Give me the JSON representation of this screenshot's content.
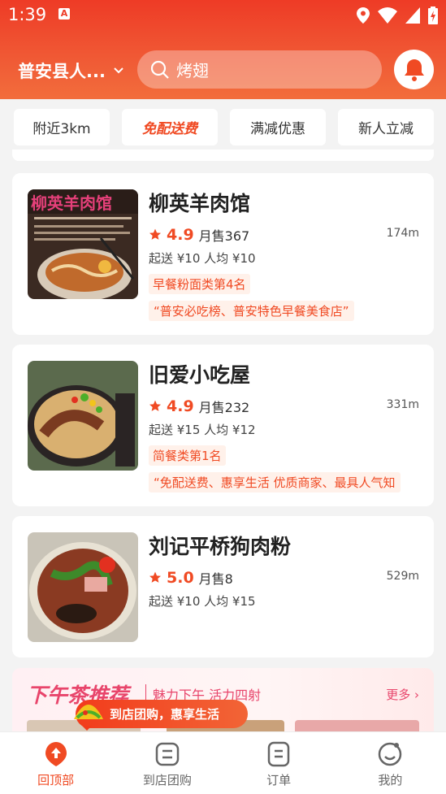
{
  "status": {
    "time": "1:39",
    "a_badge": "A"
  },
  "header": {
    "location": "普安县人...",
    "search_placeholder": "烤翅"
  },
  "filters": [
    "附近3km",
    "免配送费",
    "满减优惠",
    "新人立减"
  ],
  "stores": [
    {
      "name": "柳英羊肉馆",
      "rating": "4.9",
      "sold": "月售367",
      "distance": "174m",
      "fees": "起送 ¥10  人均 ¥10",
      "rank": "早餐粉面类第4名",
      "desc": "“普安必吃榜、普安特色早餐美食店”",
      "thumb_text": "柳英羊肉馆"
    },
    {
      "name": "旧爱小吃屋",
      "rating": "4.9",
      "sold": "月售232",
      "distance": "331m",
      "fees": "起送 ¥15  人均 ¥12",
      "rank": "简餐类第1名",
      "desc": "“免配送费、惠享生活 优质商家、最具人气知"
    },
    {
      "name": "刘记平桥狗肉粉",
      "rating": "5.0",
      "sold": "月售8",
      "distance": "529m",
      "fees": "起送 ¥10  人均 ¥15"
    }
  ],
  "tea": {
    "title": "下午茶推荐",
    "subtitle": "魅力下午 活力四射",
    "more": "更多 ›"
  },
  "promo": "到店团购，惠享生活",
  "nav": [
    "回顶部",
    "到店团购",
    "订单",
    "我的"
  ],
  "colors": {
    "brand": "#f04a23",
    "tea": "#e8456b"
  }
}
